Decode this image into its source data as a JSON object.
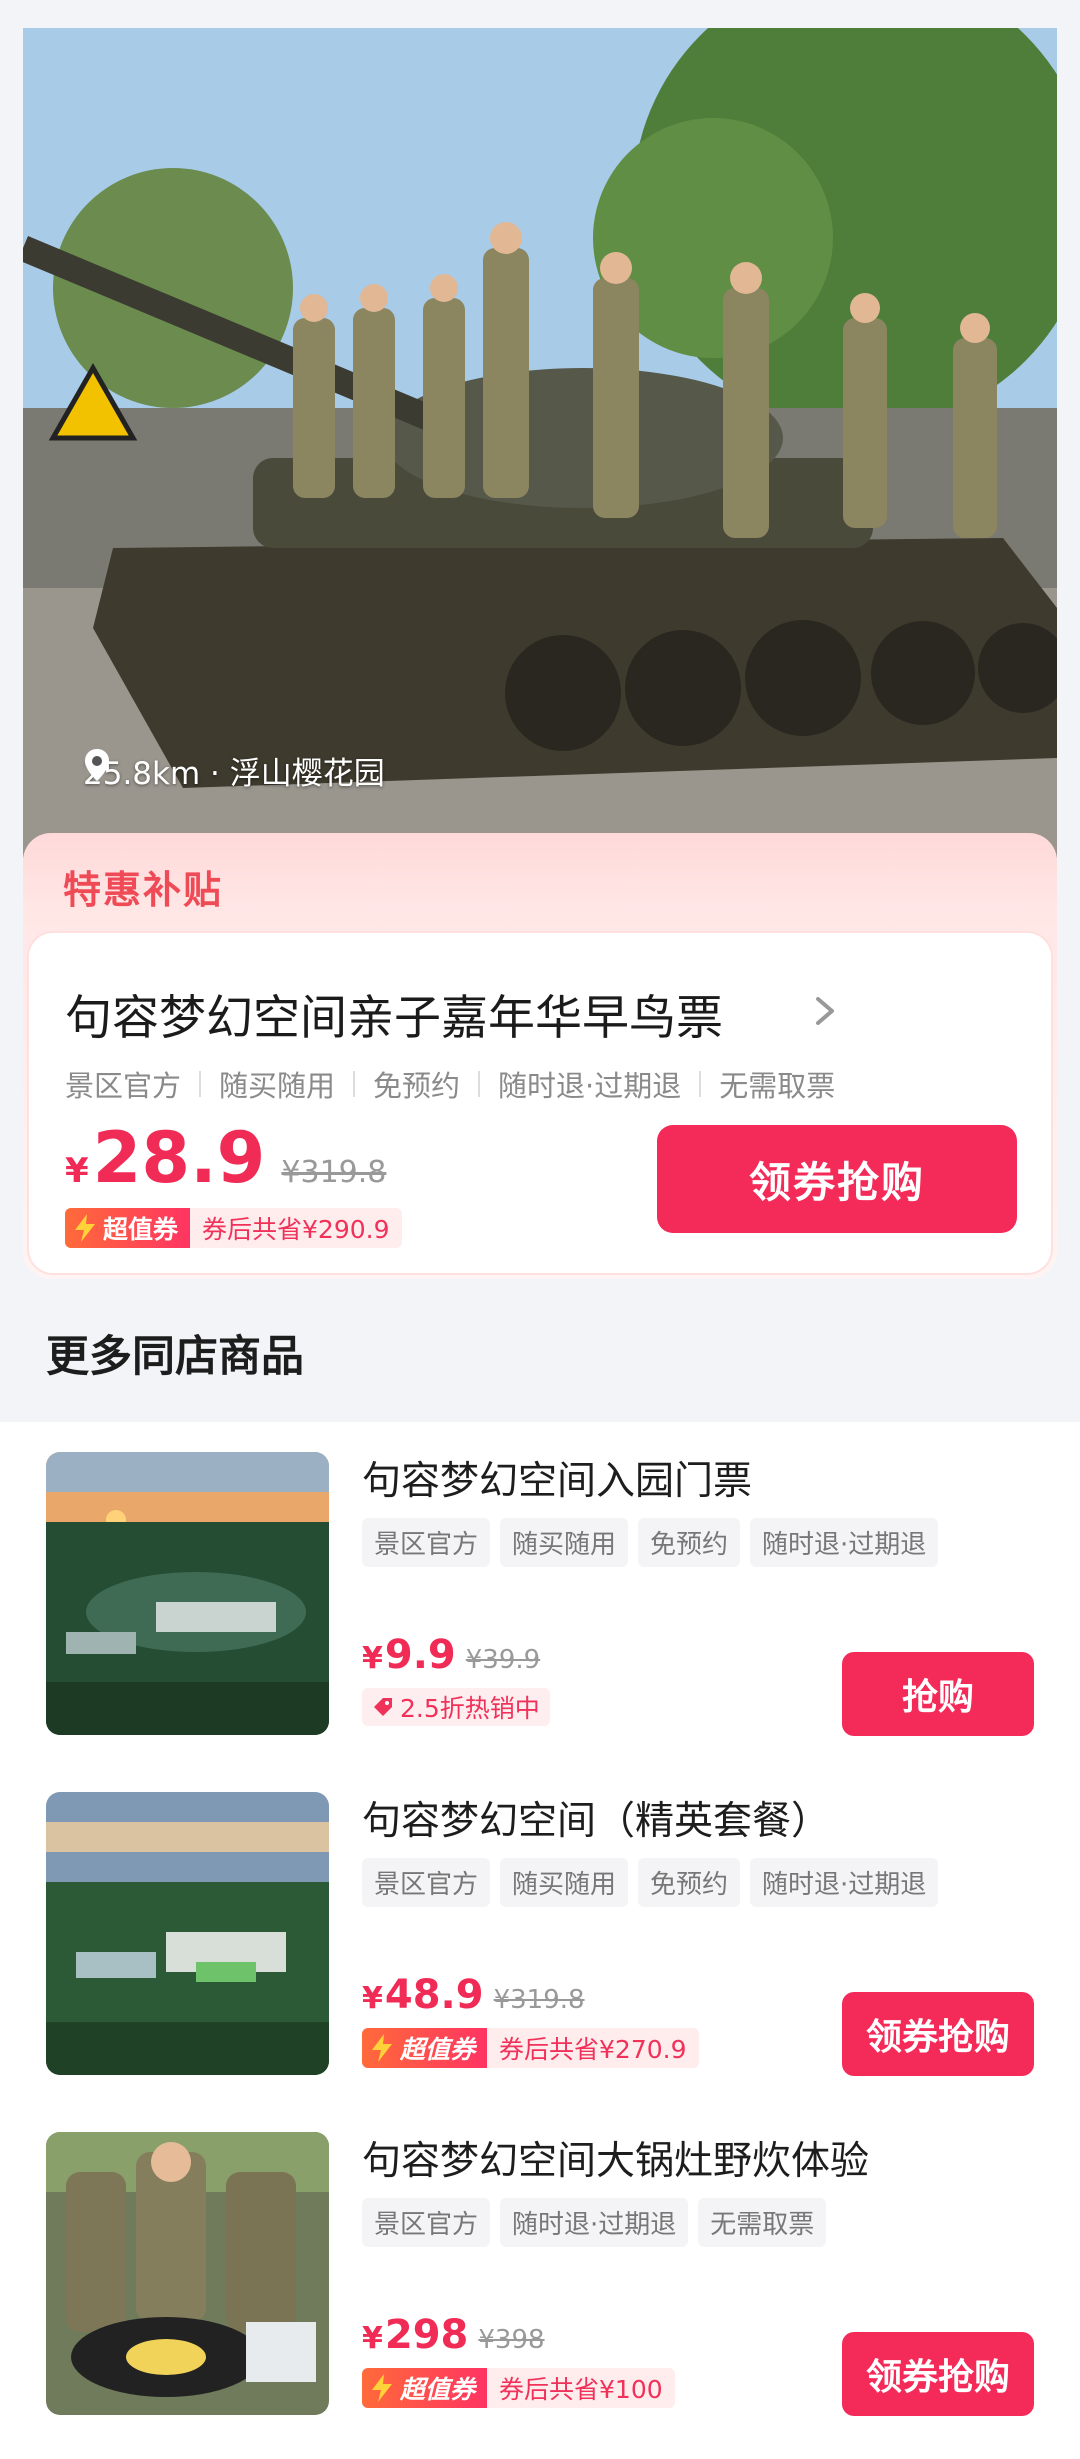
{
  "hero": {
    "location": "25.8km · 浮山樱花园",
    "image": "children-saluting-on-tank-photo"
  },
  "deal": {
    "promo_label": "特惠补贴",
    "title": "句容梦幻空间亲子嘉年华早鸟票",
    "tags": [
      "景区官方",
      "随买随用",
      "免预约",
      "随时退·过期退",
      "无需取票"
    ],
    "currency": "¥",
    "price": "28.9",
    "original_price": "¥319.8",
    "coupon_badge": "超值券",
    "coupon_text": "券后共省¥290.9",
    "button": "领券抢购"
  },
  "more": {
    "title": "更多同店商品",
    "items": [
      {
        "title": "句容梦幻空间入园门票",
        "tags": [
          "景区官方",
          "随买随用",
          "免预约",
          "随时退·过期退"
        ],
        "currency": "¥",
        "price": "9.9",
        "original_price": "¥39.9",
        "hot_label": "2.5折热销中",
        "button": "抢购",
        "thumb": "aerial-sunset-photo"
      },
      {
        "title": "句容梦幻空间（精英套餐）",
        "tags": [
          "景区官方",
          "随买随用",
          "免预约",
          "随时退·过期退"
        ],
        "currency": "¥",
        "price": "48.9",
        "original_price": "¥319.8",
        "coupon_badge": "超值券",
        "coupon_text": "券后共省¥270.9",
        "button": "领券抢购",
        "thumb": "aerial-park-photo"
      },
      {
        "title": "句容梦幻空间大锅灶野炊体验",
        "tags": [
          "景区官方",
          "随时退·过期退",
          "无需取票"
        ],
        "currency": "¥",
        "price": "298",
        "original_price": "¥398",
        "coupon_badge": "超值券",
        "coupon_text": "券后共省¥100",
        "button": "领券抢购",
        "thumb": "kids-cooking-photo"
      }
    ]
  },
  "colors": {
    "accent": "#f42a58",
    "price": "#f02c56",
    "promo": "#ef4b57"
  }
}
